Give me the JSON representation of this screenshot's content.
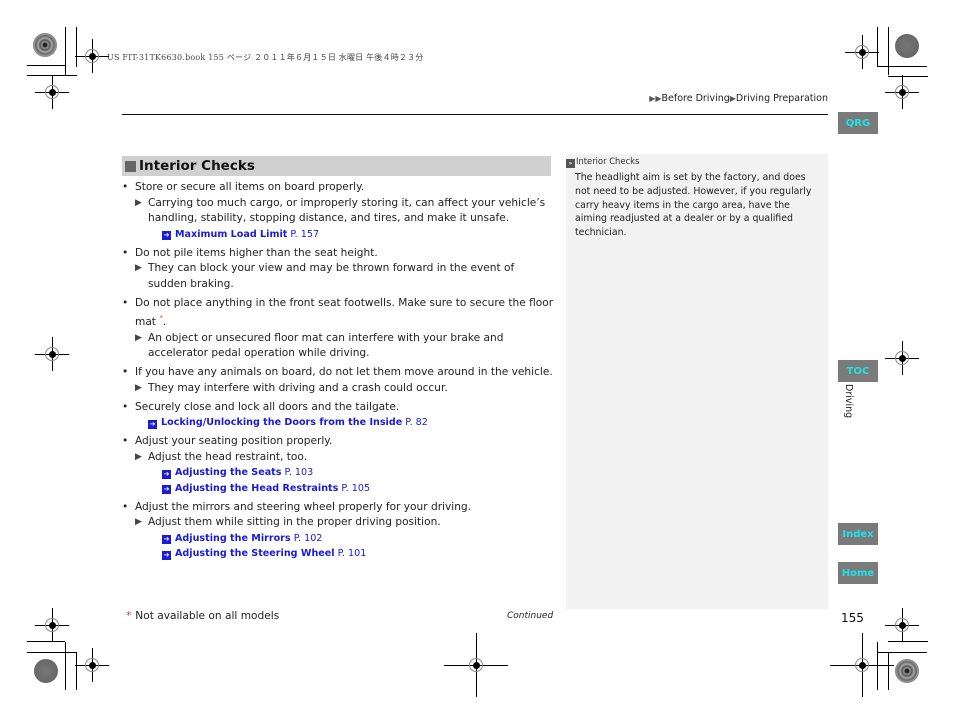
{
  "print_header": "US FIT-31TK6630.book  155 ページ  ２０１１年６月１５日  水曜日  午後４時２３分",
  "breadcrumb": {
    "prefix_icon": "double-triangle-icon",
    "items": [
      "Before Driving",
      "Driving Preparation"
    ],
    "separator_icon": "triangle-right-icon"
  },
  "side_tabs": {
    "qrg": "QRG",
    "toc": "TOC",
    "index": "Index",
    "home": "Home",
    "chapter": "Driving"
  },
  "section": {
    "title": "Interior Checks",
    "items": [
      {
        "text": "Store or secure all items on board properly.",
        "subs": [
          {
            "text": "Carrying too much cargo, or improperly storing it, can affect your vehicle’s handling, stability, stopping distance, and tires, and make it unsafe.",
            "xrefs": [
              {
                "title": "Maximum Load Limit",
                "page": "P. 157"
              }
            ]
          }
        ]
      },
      {
        "text": "Do not pile items higher than the seat height.",
        "subs": [
          {
            "text": "They can block your view and may be thrown forward in the event of sudden braking.",
            "xrefs": []
          }
        ]
      },
      {
        "text": "Do not place anything in the front seat footwells. Make sure to secure the floor mat",
        "star": "*",
        "text_after": ".",
        "subs": [
          {
            "text": "An object or unsecured floor mat can interfere with your brake and accelerator pedal operation while driving.",
            "xrefs": []
          }
        ]
      },
      {
        "text": "If you have any animals on board, do not let them move around in the vehicle.",
        "subs": [
          {
            "text": "They may interfere with driving and a crash could occur.",
            "xrefs": []
          }
        ]
      },
      {
        "text": "Securely close and lock all doors and the tailgate.",
        "xrefs": [
          {
            "title": "Locking/Unlocking the Doors from the Inside",
            "page": "P. 82"
          }
        ]
      },
      {
        "text": "Adjust your seating position properly.",
        "subs": [
          {
            "text": "Adjust the head restraint, too.",
            "xrefs": [
              {
                "title": "Adjusting the Seats",
                "page": "P. 103"
              },
              {
                "title": "Adjusting the Head Restraints",
                "page": "P. 105"
              }
            ]
          }
        ]
      },
      {
        "text": "Adjust the mirrors and steering wheel properly for your driving.",
        "subs": [
          {
            "text": "Adjust them while sitting in the proper driving position.",
            "xrefs": [
              {
                "title": "Adjusting the Mirrors",
                "page": "P. 102"
              },
              {
                "title": "Adjusting the Steering Wheel",
                "page": "P. 101"
              }
            ]
          }
        ]
      }
    ]
  },
  "note": {
    "heading": "Interior Checks",
    "body": "The headlight aim is set by the factory, and does not need to be adjusted. However, if you regularly carry heavy items in the cargo area, have the aiming readjusted at a dealer or by a qualified technician."
  },
  "footer": {
    "footnote_star": "*",
    "footnote": "Not available on all models",
    "continued": "Continued",
    "page_number": "155"
  },
  "colors": {
    "link": "#1a1adb",
    "tab_bg": "#7a7a7a",
    "tab_text": "#1fe3e8",
    "note_bg": "#f2f2f2",
    "heading_bg": "#d0d0d0",
    "asterisk": "#e23a3a"
  }
}
